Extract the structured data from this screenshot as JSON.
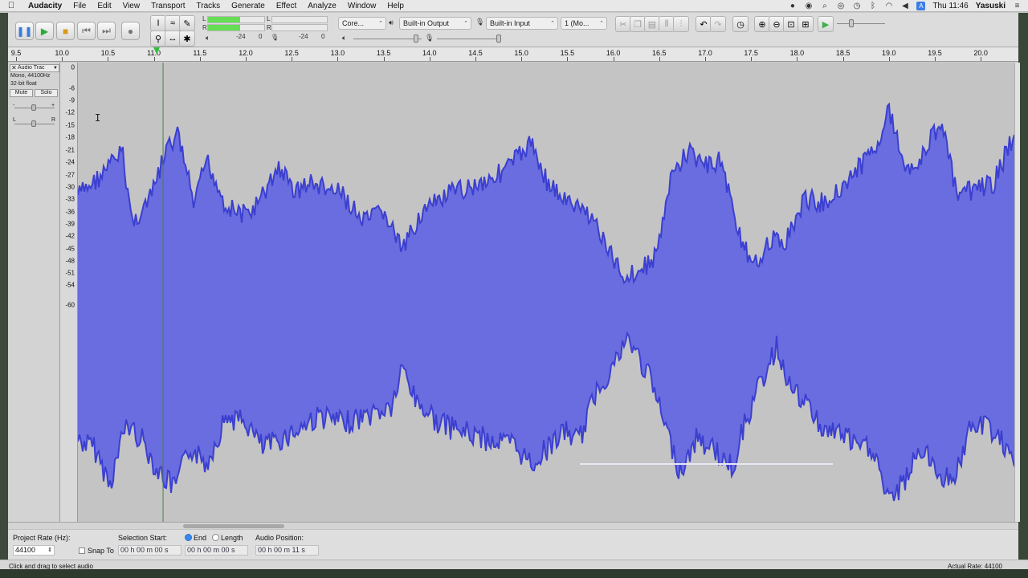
{
  "menubar": {
    "app_name": "Audacity",
    "items": [
      "File",
      "Edit",
      "View",
      "Transport",
      "Tracks",
      "Generate",
      "Effect",
      "Analyze",
      "Window",
      "Help"
    ],
    "clock": "Thu 11:46",
    "user": "Yasuski"
  },
  "toolbar": {
    "host_value": "Core...",
    "output_device": "Built-in Output",
    "input_device": "Built-in Input",
    "channels_value": "1 (Mo...",
    "meter_labels": [
      "L",
      "R",
      "L",
      "R"
    ],
    "meter_db_left": "-24",
    "meter_zero": "0",
    "meter_db_right": "-24",
    "meter_zero_right": "0"
  },
  "ruler": {
    "ticks": [
      "9.5",
      "10.0",
      "10.5",
      "11.0",
      "11.5",
      "12.0",
      "12.5",
      "13.0",
      "13.5",
      "14.0",
      "14.5",
      "15.0",
      "15.5",
      "16.0",
      "16.5",
      "17.0",
      "17.5",
      "18.0",
      "18.5",
      "19.0",
      "19.5",
      "20.0"
    ],
    "playhead_time": 11.1
  },
  "track": {
    "name": "Audio Trac",
    "format_line1": "Mono, 44100Hz",
    "format_line2": "32-bit float",
    "mute_label": "Mute",
    "solo_label": "Solo",
    "pan_left": "L",
    "pan_right": "R",
    "gain_min": "-",
    "gain_max": "+",
    "waveform_color": "#6a6ddf",
    "waveform_edge_color": "#3b3fd0"
  },
  "db_scale": [
    "0",
    "-6",
    "-9",
    "-12",
    "-15",
    "-18",
    "-21",
    "-24",
    "-27",
    "-30",
    "-33",
    "-36",
    "-39",
    "-42",
    "-45",
    "-48",
    "-51",
    "-54",
    "-60"
  ],
  "selection_toolbar": {
    "project_rate_label": "Project Rate (Hz):",
    "project_rate_value": "44100",
    "snap_to_label": "Snap To",
    "selection_start_label": "Selection Start:",
    "end_label": "End",
    "length_label": "Length",
    "audio_position_label": "Audio Position:",
    "selection_start_value": "00 h 00 m 00 s",
    "selection_end_value": "00 h 00 m 00 s",
    "audio_position_value": "00 h 00 m 11 s",
    "end_selected": true
  },
  "statusbar": {
    "message": "Click and drag to select audio",
    "actual_rate": "Actual Rate: 44100"
  }
}
